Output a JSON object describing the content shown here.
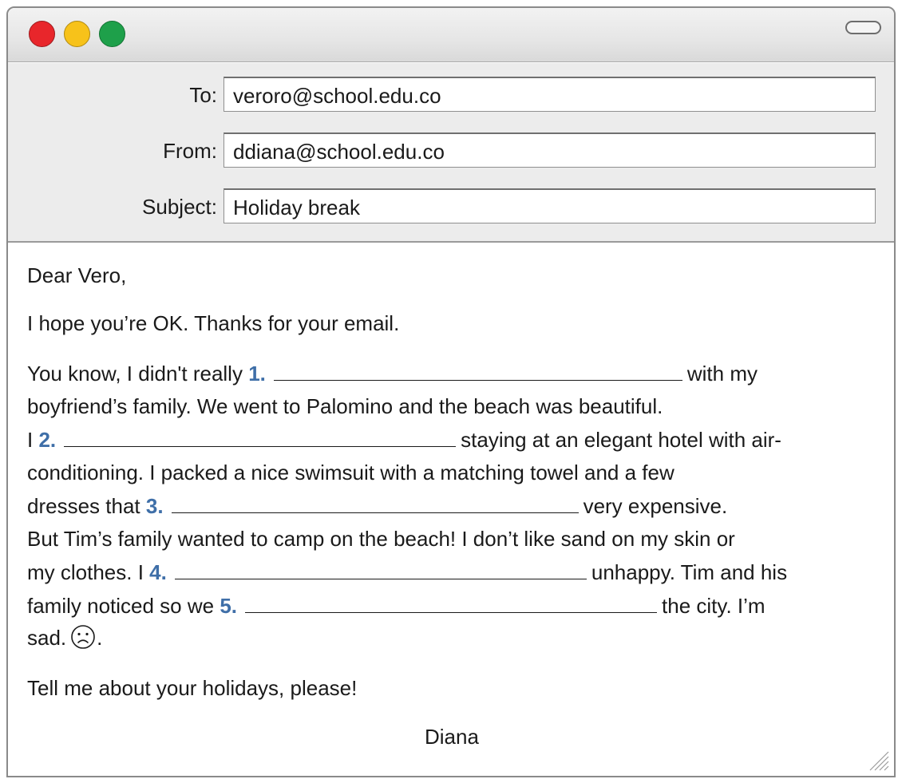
{
  "window": {
    "controls": [
      "close",
      "minimize",
      "zoom"
    ],
    "toolbar_toggle_icon": "pill-button-icon"
  },
  "header": {
    "to_label": "To:",
    "to_value": "veroro@school.edu.co",
    "from_label": "From:",
    "from_value": "ddiana@school.edu.co",
    "subject_label": "Subject:",
    "subject_value": "Holiday break"
  },
  "message": {
    "greeting": "Dear Vero,",
    "line1": "I hope you’re OK. Thanks for your email.",
    "p_l1_a": "You know, I didn't really",
    "n1": "1.",
    "p_l1_b": "with my",
    "p_l2": "boyfriend’s family. We went to Palomino and the beach was beautiful.",
    "p_l3_a": "I",
    "n2": "2.",
    "p_l3_b": "staying at an elegant hotel with air-",
    "p_l4": "conditioning. I packed a nice swimsuit with a matching towel and a few",
    "p_l5_a": "dresses that",
    "n3": "3.",
    "p_l5_b": "very expensive.",
    "p_l6": "But Tim’s family wanted to camp on the beach! I don’t like sand on my skin or",
    "p_l7_a": "my clothes. I",
    "n4": "4.",
    "p_l7_b": "unhappy. Tim and his",
    "p_l8_a": "family noticed so we",
    "n5": "5.",
    "p_l8_b": "the city. I’m",
    "p_l9_a": "sad.",
    "p_l9_b": ".",
    "closing_line": "Tell me about your holidays, please!",
    "signature": "Diana",
    "emoji_icon": "sad-face-icon"
  },
  "colors": {
    "number_accent": "#3f6fa8",
    "close": "#e8262b",
    "minimize": "#f7c21a",
    "zoom": "#1ea04a"
  }
}
